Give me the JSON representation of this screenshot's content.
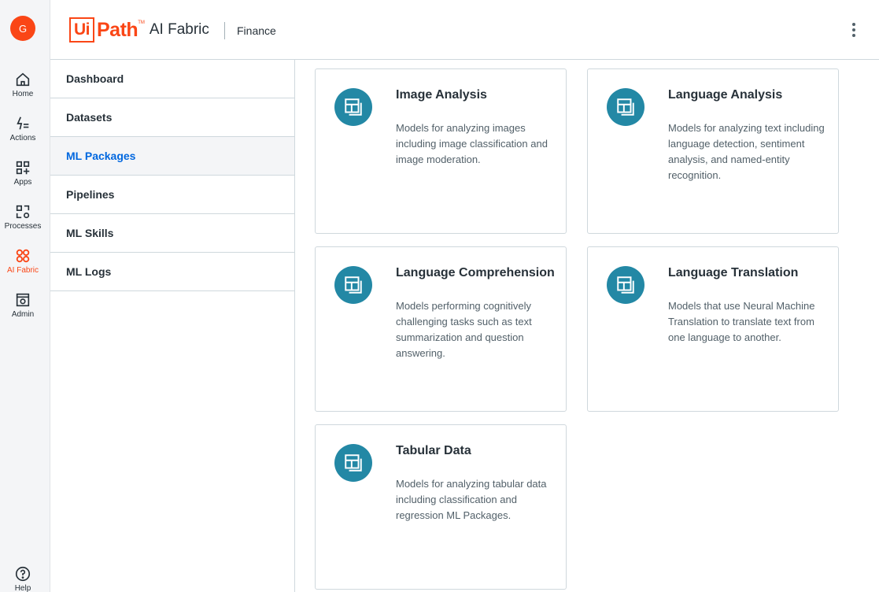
{
  "user": {
    "initial": "G"
  },
  "rail": {
    "items": [
      {
        "label": "Home",
        "icon": "home-icon"
      },
      {
        "label": "Actions",
        "icon": "actions-icon"
      },
      {
        "label": "Apps",
        "icon": "apps-icon"
      },
      {
        "label": "Processes",
        "icon": "processes-icon"
      },
      {
        "label": "AI Fabric",
        "icon": "ai-fabric-icon",
        "active": true
      },
      {
        "label": "Admin",
        "icon": "admin-icon"
      }
    ],
    "help": {
      "label": "Help",
      "icon": "help-icon"
    }
  },
  "header": {
    "logo_ui": "Ui",
    "logo_path": "Path",
    "logo_tm": "TM",
    "product": "AI Fabric",
    "tenant": "Finance"
  },
  "subnav": {
    "items": [
      {
        "label": "Dashboard"
      },
      {
        "label": "Datasets"
      },
      {
        "label": "ML Packages",
        "active": true
      },
      {
        "label": "Pipelines"
      },
      {
        "label": "ML Skills"
      },
      {
        "label": "ML Logs"
      }
    ]
  },
  "cards": [
    {
      "title": "Image Analysis",
      "description": "Models for analyzing images including image classification and image moderation."
    },
    {
      "title": "Language Analysis",
      "description": "Models for analyzing text including language detection, sentiment analysis, and named-entity recognition."
    },
    {
      "title": "Language Comprehension",
      "description": "Models performing cognitively challenging tasks such as text summarization and question answering."
    },
    {
      "title": "Language Translation",
      "description": "Models that use Neural Machine Translation to translate text from one language to another."
    },
    {
      "title": "Tabular Data",
      "description": "Models for analyzing tabular data including classification and regression ML Packages."
    }
  ],
  "colors": {
    "brand": "#fa4616",
    "active_link": "#0067df",
    "card_icon": "#2388a5"
  }
}
